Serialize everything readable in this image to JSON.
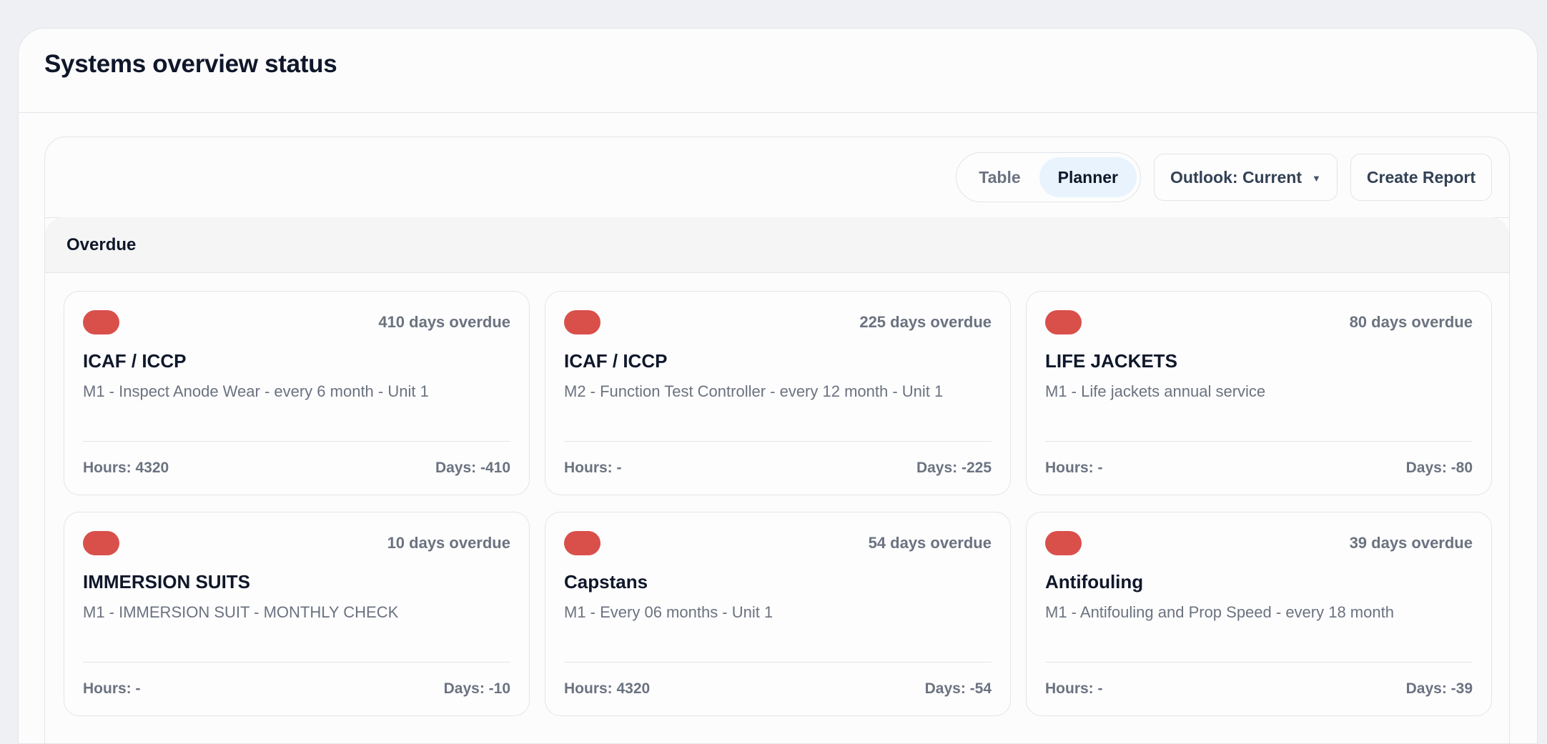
{
  "page": {
    "title": "Systems overview status"
  },
  "toolbar": {
    "view_options": [
      "Table",
      "Planner"
    ],
    "active_view": "Planner",
    "outlook_label": "Outlook: Current",
    "create_report_label": "Create Report"
  },
  "colors": {
    "status_overdue": "#d9504b",
    "toggle_active_bg": "#e8f3fd"
  },
  "section": {
    "title": "Overdue"
  },
  "cards": [
    {
      "overdue": "410 days overdue",
      "title": "ICAF / ICCP",
      "desc": "M1 - Inspect Anode Wear - every 6 month - Unit 1",
      "hours": "Hours: 4320",
      "days": "Days: -410"
    },
    {
      "overdue": "225 days overdue",
      "title": "ICAF / ICCP",
      "desc": "M2 - Function Test Controller - every 12 month - Unit 1",
      "hours": "Hours: -",
      "days": "Days: -225"
    },
    {
      "overdue": "80 days overdue",
      "title": "LIFE JACKETS",
      "desc": "M1 - Life jackets annual service",
      "hours": "Hours: -",
      "days": "Days: -80"
    },
    {
      "overdue": "10 days overdue",
      "title": "IMMERSION SUITS",
      "desc": "M1 - IMMERSION SUIT - MONTHLY CHECK",
      "hours": "Hours: -",
      "days": "Days: -10"
    },
    {
      "overdue": "54 days overdue",
      "title": "Capstans",
      "desc": "M1 - Every 06 months - Unit 1",
      "hours": "Hours: 4320",
      "days": "Days: -54"
    },
    {
      "overdue": "39 days overdue",
      "title": "Antifouling",
      "desc": "M1 - Antifouling and Prop Speed - every 18 month",
      "hours": "Hours: -",
      "days": "Days: -39"
    }
  ]
}
